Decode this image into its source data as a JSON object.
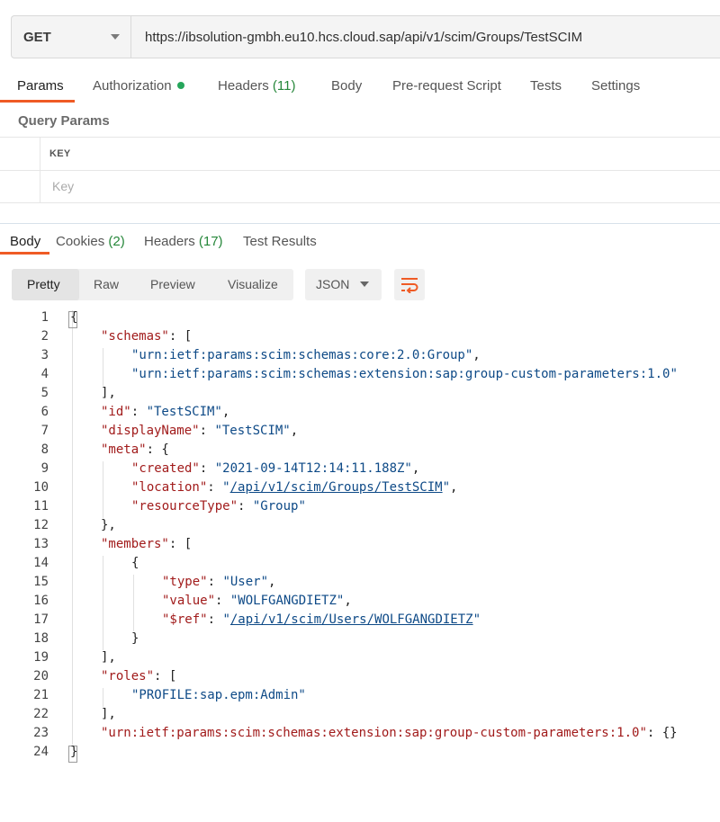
{
  "request": {
    "method": "GET",
    "url": "https://ibsolution-gmbh.eu10.hcs.cloud.sap/api/v1/scim/Groups/TestSCIM"
  },
  "request_tabs": {
    "params": "Params",
    "authorization": "Authorization",
    "headers": "Headers",
    "headers_count": "(11)",
    "body": "Body",
    "prerequest": "Pre-request Script",
    "tests": "Tests",
    "settings": "Settings"
  },
  "query_params": {
    "title": "Query Params",
    "key_header": "KEY",
    "key_placeholder": "Key"
  },
  "response_tabs": {
    "body": "Body",
    "cookies": "Cookies",
    "cookies_count": "(2)",
    "headers": "Headers",
    "headers_count": "(17)",
    "test_results": "Test Results"
  },
  "view_options": {
    "pretty": "Pretty",
    "raw": "Raw",
    "preview": "Preview",
    "visualize": "Visualize",
    "format": "JSON",
    "wrap_icon": "wrap-lines-icon"
  },
  "colors": {
    "accent": "#ef5b25",
    "count_green": "#26873a",
    "json_key": "#a11b1b",
    "json_string": "#0e4a87"
  },
  "code_lines": [
    {
      "n": "1",
      "indent": 0,
      "parts": [
        {
          "t": "p",
          "v": "{"
        }
      ]
    },
    {
      "n": "2",
      "indent": 1,
      "parts": [
        {
          "t": "k",
          "v": "\"schemas\""
        },
        {
          "t": "p",
          "v": ": ["
        }
      ]
    },
    {
      "n": "3",
      "indent": 2,
      "parts": [
        {
          "t": "s",
          "v": "\"urn:ietf:params:scim:schemas:core:2.0:Group\""
        },
        {
          "t": "p",
          "v": ","
        }
      ]
    },
    {
      "n": "4",
      "indent": 2,
      "parts": [
        {
          "t": "s",
          "v": "\"urn:ietf:params:scim:schemas:extension:sap:group-custom-parameters:1.0\""
        }
      ]
    },
    {
      "n": "5",
      "indent": 1,
      "parts": [
        {
          "t": "p",
          "v": "],"
        }
      ]
    },
    {
      "n": "6",
      "indent": 1,
      "parts": [
        {
          "t": "k",
          "v": "\"id\""
        },
        {
          "t": "p",
          "v": ": "
        },
        {
          "t": "s",
          "v": "\"TestSCIM\""
        },
        {
          "t": "p",
          "v": ","
        }
      ]
    },
    {
      "n": "7",
      "indent": 1,
      "parts": [
        {
          "t": "k",
          "v": "\"displayName\""
        },
        {
          "t": "p",
          "v": ": "
        },
        {
          "t": "s",
          "v": "\"TestSCIM\""
        },
        {
          "t": "p",
          "v": ","
        }
      ]
    },
    {
      "n": "8",
      "indent": 1,
      "parts": [
        {
          "t": "k",
          "v": "\"meta\""
        },
        {
          "t": "p",
          "v": ": {"
        }
      ]
    },
    {
      "n": "9",
      "indent": 2,
      "parts": [
        {
          "t": "k",
          "v": "\"created\""
        },
        {
          "t": "p",
          "v": ": "
        },
        {
          "t": "s",
          "v": "\"2021-09-14T12:14:11.188Z\""
        },
        {
          "t": "p",
          "v": ","
        }
      ]
    },
    {
      "n": "10",
      "indent": 2,
      "parts": [
        {
          "t": "k",
          "v": "\"location\""
        },
        {
          "t": "p",
          "v": ": "
        },
        {
          "t": "s",
          "v": "\""
        },
        {
          "t": "l",
          "v": "/api/v1/scim/Groups/TestSCIM"
        },
        {
          "t": "s",
          "v": "\""
        },
        {
          "t": "p",
          "v": ","
        }
      ]
    },
    {
      "n": "11",
      "indent": 2,
      "parts": [
        {
          "t": "k",
          "v": "\"resourceType\""
        },
        {
          "t": "p",
          "v": ": "
        },
        {
          "t": "s",
          "v": "\"Group\""
        }
      ]
    },
    {
      "n": "12",
      "indent": 1,
      "parts": [
        {
          "t": "p",
          "v": "},"
        }
      ]
    },
    {
      "n": "13",
      "indent": 1,
      "parts": [
        {
          "t": "k",
          "v": "\"members\""
        },
        {
          "t": "p",
          "v": ": ["
        }
      ]
    },
    {
      "n": "14",
      "indent": 2,
      "parts": [
        {
          "t": "p",
          "v": "{"
        }
      ]
    },
    {
      "n": "15",
      "indent": 3,
      "parts": [
        {
          "t": "k",
          "v": "\"type\""
        },
        {
          "t": "p",
          "v": ": "
        },
        {
          "t": "s",
          "v": "\"User\""
        },
        {
          "t": "p",
          "v": ","
        }
      ]
    },
    {
      "n": "16",
      "indent": 3,
      "parts": [
        {
          "t": "k",
          "v": "\"value\""
        },
        {
          "t": "p",
          "v": ": "
        },
        {
          "t": "s",
          "v": "\"WOLFGANGDIETZ\""
        },
        {
          "t": "p",
          "v": ","
        }
      ]
    },
    {
      "n": "17",
      "indent": 3,
      "parts": [
        {
          "t": "k",
          "v": "\"$ref\""
        },
        {
          "t": "p",
          "v": ": "
        },
        {
          "t": "s",
          "v": "\""
        },
        {
          "t": "l",
          "v": "/api/v1/scim/Users/WOLFGANGDIETZ"
        },
        {
          "t": "s",
          "v": "\""
        }
      ]
    },
    {
      "n": "18",
      "indent": 2,
      "parts": [
        {
          "t": "p",
          "v": "}"
        }
      ]
    },
    {
      "n": "19",
      "indent": 1,
      "parts": [
        {
          "t": "p",
          "v": "],"
        }
      ]
    },
    {
      "n": "20",
      "indent": 1,
      "parts": [
        {
          "t": "k",
          "v": "\"roles\""
        },
        {
          "t": "p",
          "v": ": ["
        }
      ]
    },
    {
      "n": "21",
      "indent": 2,
      "parts": [
        {
          "t": "s",
          "v": "\"PROFILE:sap.epm:Admin\""
        }
      ]
    },
    {
      "n": "22",
      "indent": 1,
      "parts": [
        {
          "t": "p",
          "v": "],"
        }
      ]
    },
    {
      "n": "23",
      "indent": 1,
      "parts": [
        {
          "t": "k",
          "v": "\"urn:ietf:params:scim:schemas:extension:sap:group-custom-parameters:1.0\""
        },
        {
          "t": "p",
          "v": ": {}"
        }
      ]
    },
    {
      "n": "24",
      "indent": 0,
      "parts": [
        {
          "t": "p",
          "v": "}"
        }
      ]
    }
  ]
}
